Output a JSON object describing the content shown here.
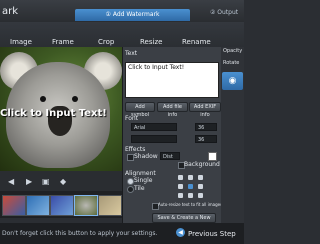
{
  "app_title": "ark",
  "tab_active": "① Add Watermark",
  "output_label": "② Output",
  "toolbar": {
    "items": [
      "Image",
      "Frame",
      "Crop",
      "Resize",
      "Rename"
    ]
  },
  "canvas": {
    "watermark_text": "Click to Input Text!"
  },
  "controls": {
    "prev": "◀",
    "next": "▶",
    "fit": "▣",
    "extra": "◆"
  },
  "panel": {
    "text_section": "Text",
    "text_value": "Click to Input Text!",
    "buttons": {
      "add_symbol": "Add symbol",
      "add_file_info": "Add file info",
      "add_exif_info": "Add EXIF info"
    },
    "font_section": "Font",
    "font_name": "Arial",
    "size_value": "36",
    "style_value": "",
    "size2_value": "36",
    "effect_section": "Effects",
    "shadow_label": "Shadow",
    "shadow_value": "Dist",
    "background_label": "Background",
    "alignment_section": "Alignment",
    "single_label": "Single",
    "tile_label": "Tile",
    "auto_resize_label": "Auto-resize text to fit all images",
    "save_button": "Save & Create a New Layer"
  },
  "side": {
    "opacity_label": "Opacity",
    "rotate_label": "Rotate"
  },
  "footer": {
    "hint": "Don't forget click this button to apply your settings.",
    "prev_step": "Previous Step",
    "prev_arrow": "◀"
  },
  "colors": {
    "accent": "#4a90d0"
  }
}
